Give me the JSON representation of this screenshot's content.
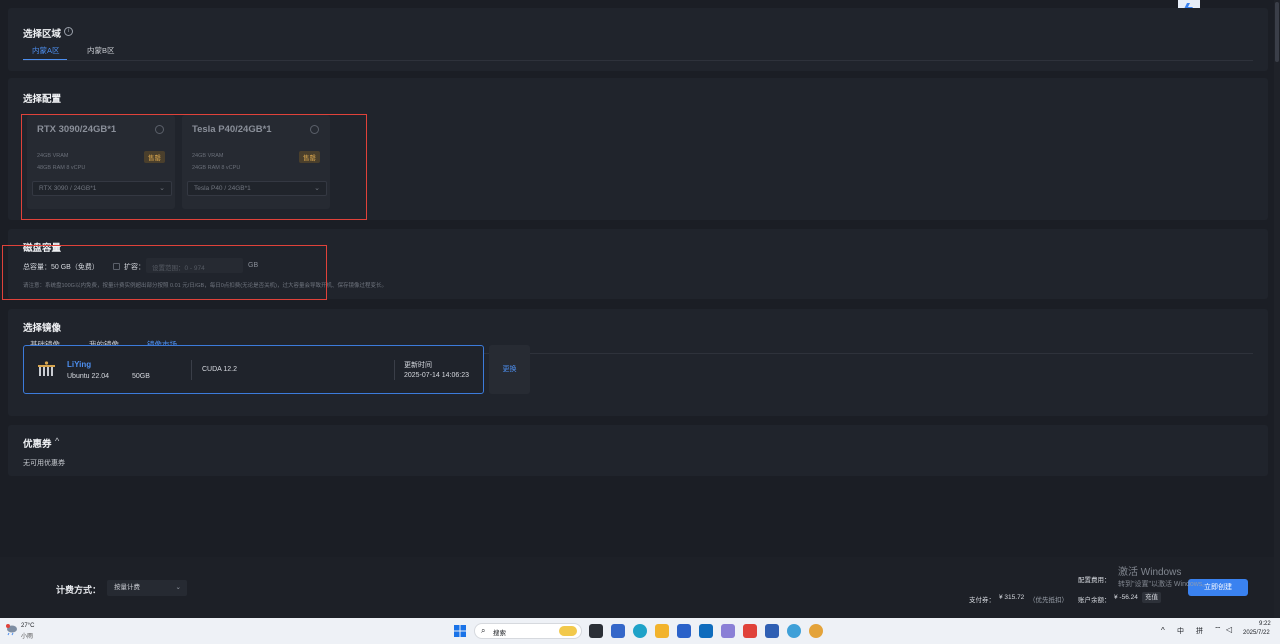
{
  "region": {
    "title": "选择区域",
    "tabs": [
      {
        "label": "内蒙A区",
        "active": true
      },
      {
        "label": "内蒙B区",
        "active": false
      }
    ]
  },
  "config": {
    "title": "选择配置",
    "gpus": [
      {
        "name": "RTX 3090/24GB*1",
        "vram": "24GB VRAM",
        "ram": "48GB RAM 8 vCPU",
        "badge": "售罄",
        "select": "RTX 3090 / 24GB*1"
      },
      {
        "name": "Tesla P40/24GB*1",
        "vram": "24GB VRAM",
        "ram": "24GB RAM 8 vCPU",
        "badge": "售罄",
        "select": "Tesla P40 / 24GB*1"
      }
    ]
  },
  "disk": {
    "title": "磁盘容量",
    "total_label": "总容量：",
    "total_value": "50 GB（免费）",
    "expand_label": "扩容：",
    "expand_placeholder": "设置范围：0 - 974",
    "unit": "GB",
    "note": "请注意：系统盘100G以内免费，按量计费实例超出部分按照 0.01 元/日/GB，每日0点扣费(无论是否关机)，过大容量会导致开机、保存镜像过程变长。"
  },
  "image": {
    "title": "选择镜像",
    "tabs": [
      {
        "label": "基础镜像",
        "active": false
      },
      {
        "label": "我的镜像",
        "active": false
      },
      {
        "label": "镜像市场",
        "active": true
      }
    ],
    "selected": {
      "name": "LiYing",
      "os": "Ubuntu 22.04",
      "size": "50GB",
      "cuda": "CUDA 12.2",
      "update_label": "更新时间",
      "update_time": "2025-07-14 14:06:23"
    },
    "switch_label": "更换"
  },
  "coupon": {
    "title": "优惠券",
    "toggle": "^",
    "empty": "无可用优惠券"
  },
  "billing": {
    "method_label": "计费方式：",
    "method_value": "按量计费",
    "config_fee_label": "配置费用：",
    "payment_label": "支付券：",
    "payment_value": "¥ 315.72",
    "payment_note": "（优先抵扣）",
    "balance_label": "账户余额：",
    "balance_value": "¥ -56.24",
    "recharge_label": "充值",
    "create_label": "立即创建"
  },
  "watermark": {
    "line1": "激活 Windows",
    "line2": "转到\"设置\"以激活 Windows。"
  },
  "taskbar": {
    "weather_temp": "27°C",
    "weather_desc": "小雨",
    "search_placeholder": "搜索",
    "ime1": "中",
    "ime2": "拼",
    "time": "9:22",
    "date": "2025/7/22"
  },
  "colors": {
    "accent": "#4d8ff0",
    "sold_badge": "#d6a44e",
    "highlight_box": "#e0423a",
    "create_button": "#3a82f0"
  }
}
